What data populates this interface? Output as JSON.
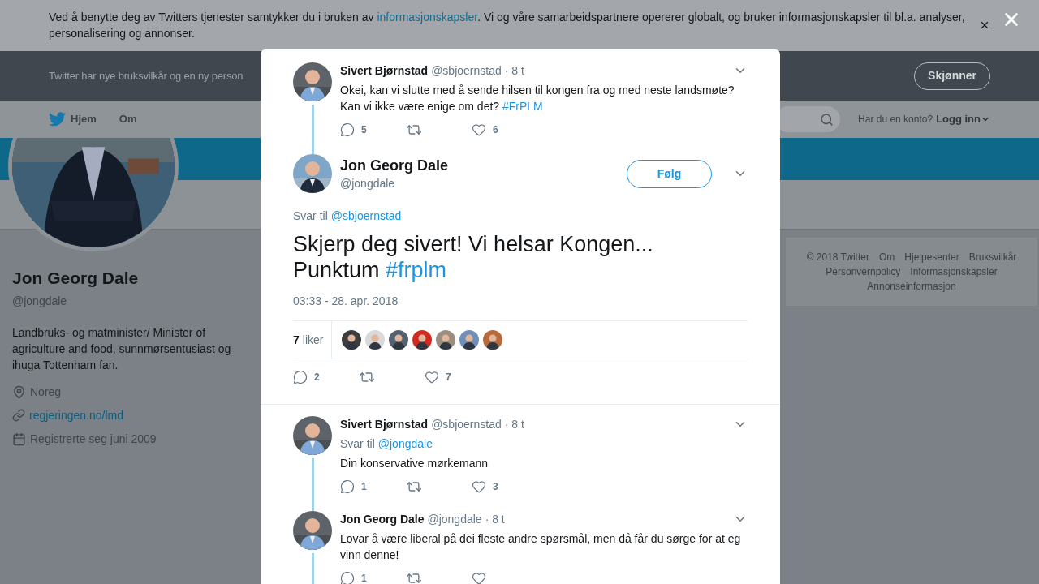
{
  "cookie_banner": {
    "text_before": "Ved å benytte deg av Twitters tjenester samtykker du i bruken av ",
    "link": "informasjonskapsler",
    "text_after": ". Vi og våre samarbeidspartnere opererer globalt, og bruker informasjonskapsler til bl.a. analyser, personalisering og annonser."
  },
  "notice_bar": {
    "text": "Twitter har nye bruksvilkår og en ny person",
    "button": "Skjønner"
  },
  "nav": {
    "items": [
      {
        "label": "Hjem",
        "kind": "home"
      },
      {
        "label": "Om",
        "kind": "plain"
      }
    ],
    "account_prompt": "Har du en konto?",
    "login": "Logg inn"
  },
  "profile": {
    "name": "Jon Georg Dale",
    "handle": "@jongdale",
    "bio": "Landbruks- og matminister/ Minister of agriculture and food, sunnmørsentusiast og ihuga Tottenham fan.",
    "location": "Noreg",
    "website": "regjeringen.no/lmd",
    "joined": "Registrerte seg juni 2009"
  },
  "footer": {
    "links": [
      "© 2018 Twitter",
      "Om",
      "Hjelpesenter",
      "Bruksvilkår",
      "Personvernpolicy",
      "Informasjonskapsler",
      "Annonseinformasjon"
    ]
  },
  "modal": {
    "parent_tweet": {
      "name": "Sivert Bjørnstad",
      "handle": "@sbjoernstad",
      "time": "· 8 t",
      "text": "Okei, kan vi slutte med å sende hilsen til kongen fra og med neste landsmøte? Kan vi ikke være enige om det? ",
      "hashtag": "#FrPLM",
      "replies": "5",
      "likes": "6",
      "thread_line": true
    },
    "main_tweet": {
      "name": "Jon Georg Dale",
      "handle": "@jongdale",
      "follow": "Følg",
      "reply_prefix": "Svar til",
      "reply_to": "@sbjoernstad",
      "text": "Skjerp deg sivert! Vi helsar Kongen... Punktum ",
      "hashtag": "#frplm",
      "timestamp": "03:33 - 28. apr. 2018",
      "like_count": "7",
      "like_label": "liker",
      "replies": "2",
      "likes": "7"
    },
    "replies": [
      {
        "name": "Sivert Bjørnstad",
        "handle": "@sbjoernstad",
        "time": "· 8 t",
        "reply_prefix": "Svar til",
        "reply_to": "@jongdale",
        "text": "Din konservative mørkemann",
        "replies": "1",
        "likes": "3",
        "thread_line": true
      },
      {
        "name": "Jon Georg Dale",
        "handle": "@jongdale",
        "time": "· 8 t",
        "text": "Lovar å være liberal på dei fleste andre spørsmål, men då får du sørge for at eg vinn denne!",
        "replies": "1",
        "thread_line": true
      }
    ]
  }
}
